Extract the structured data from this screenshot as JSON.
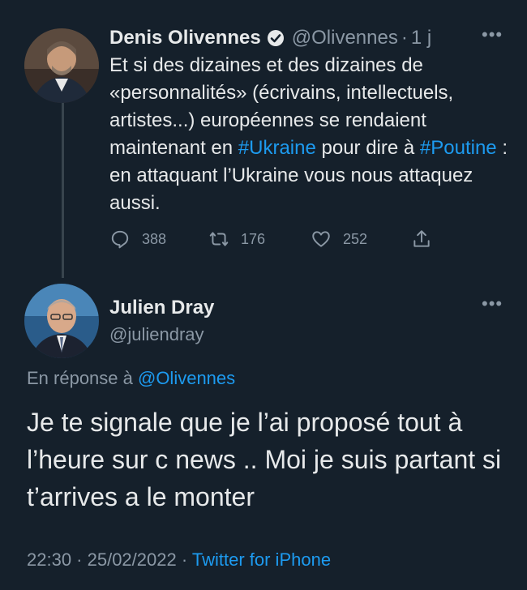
{
  "original_tweet": {
    "author_name": "Denis Olivennes",
    "handle": "@Olivennes",
    "separator": "·",
    "time_ago": "1 j",
    "text_before_hashtag1": "Et si des dizaines et des dizaines de «personnalités» (écrivains, intellectuels, artistes...) européennes se rendaient maintenant en ",
    "hashtag1": "#Ukraine",
    "text_between": " pour dire à ",
    "hashtag2": "#Poutine",
    "text_after": " : en attaquant l’Ukraine vous nous attaquez aussi.",
    "more_label": "•••",
    "actions": {
      "replies": "388",
      "retweets": "176",
      "likes": "252"
    },
    "verified_icon": "verified-badge-icon"
  },
  "reply_tweet": {
    "author_name": "Julien Dray",
    "handle": "@juliendray",
    "more_label": "•••",
    "reply_prefix": "En réponse à ",
    "reply_mention": "@Olivennes",
    "text": "Je te signale que je l’ai proposé tout à l’heure sur c news .. Moi je suis partant si t’arrives a le monter",
    "timestamp": "22:30 · 25/02/2022 · ",
    "source": "Twitter for iPhone"
  },
  "colors": {
    "background": "#15202b",
    "accent": "#1d9bf0",
    "secondary_text": "#8b98a5",
    "primary_text": "#e7e9ea"
  }
}
